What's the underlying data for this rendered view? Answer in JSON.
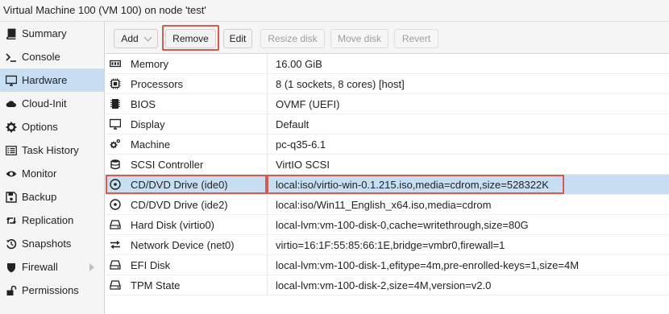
{
  "window": {
    "title": "Virtual Machine 100 (VM 100) on node 'test'"
  },
  "sidebar": {
    "items": [
      {
        "label": "Summary",
        "icon": "book-icon"
      },
      {
        "label": "Console",
        "icon": "terminal-icon"
      },
      {
        "label": "Hardware",
        "icon": "desktop-icon",
        "active": true
      },
      {
        "label": "Cloud-Init",
        "icon": "cloud-icon"
      },
      {
        "label": "Options",
        "icon": "gear-icon"
      },
      {
        "label": "Task History",
        "icon": "list-icon"
      },
      {
        "label": "Monitor",
        "icon": "eye-icon"
      },
      {
        "label": "Backup",
        "icon": "floppy-icon"
      },
      {
        "label": "Replication",
        "icon": "retweet-icon"
      },
      {
        "label": "Snapshots",
        "icon": "history-icon"
      },
      {
        "label": "Firewall",
        "icon": "shield-icon",
        "has_submenu": true
      },
      {
        "label": "Permissions",
        "icon": "unlock-icon"
      }
    ]
  },
  "toolbar": {
    "add_label": "Add",
    "remove_label": "Remove",
    "edit_label": "Edit",
    "resize_label": "Resize disk",
    "move_label": "Move disk",
    "revert_label": "Revert"
  },
  "hardware": {
    "rows": [
      {
        "name": "Memory",
        "value": "16.00 GiB",
        "icon": "memory-icon"
      },
      {
        "name": "Processors",
        "value": "8 (1 sockets, 8 cores) [host]",
        "icon": "cpu-icon"
      },
      {
        "name": "BIOS",
        "value": "OVMF (UEFI)",
        "icon": "microchip-icon"
      },
      {
        "name": "Display",
        "value": "Default",
        "icon": "desktop-icon"
      },
      {
        "name": "Machine",
        "value": "pc-q35-6.1",
        "icon": "cogs-icon"
      },
      {
        "name": "SCSI Controller",
        "value": "VirtIO SCSI",
        "icon": "database-icon"
      },
      {
        "name": "CD/DVD Drive (ide0)",
        "value": "local:iso/virtio-win-0.1.215.iso,media=cdrom,size=528322K",
        "icon": "cdrom-icon",
        "selected": true
      },
      {
        "name": "CD/DVD Drive (ide2)",
        "value": "local:iso/Win11_English_x64.iso,media=cdrom",
        "icon": "cdrom-icon"
      },
      {
        "name": "Hard Disk (virtio0)",
        "value": "local-lvm:vm-100-disk-0,cache=writethrough,size=80G",
        "icon": "hdd-icon"
      },
      {
        "name": "Network Device (net0)",
        "value": "virtio=16:1F:55:85:66:1E,bridge=vmbr0,firewall=1",
        "icon": "exchange-icon"
      },
      {
        "name": "EFI Disk",
        "value": "local-lvm:vm-100-disk-1,efitype=4m,pre-enrolled-keys=1,size=4M",
        "icon": "hdd-icon"
      },
      {
        "name": "TPM State",
        "value": "local-lvm:vm-100-disk-2,size=4M,version=v2.0",
        "icon": "hdd-icon"
      }
    ]
  },
  "colors": {
    "selection": "#c8dff3",
    "highlight": "#d65a4d",
    "sidebar_bg": "#f5f5f5"
  }
}
